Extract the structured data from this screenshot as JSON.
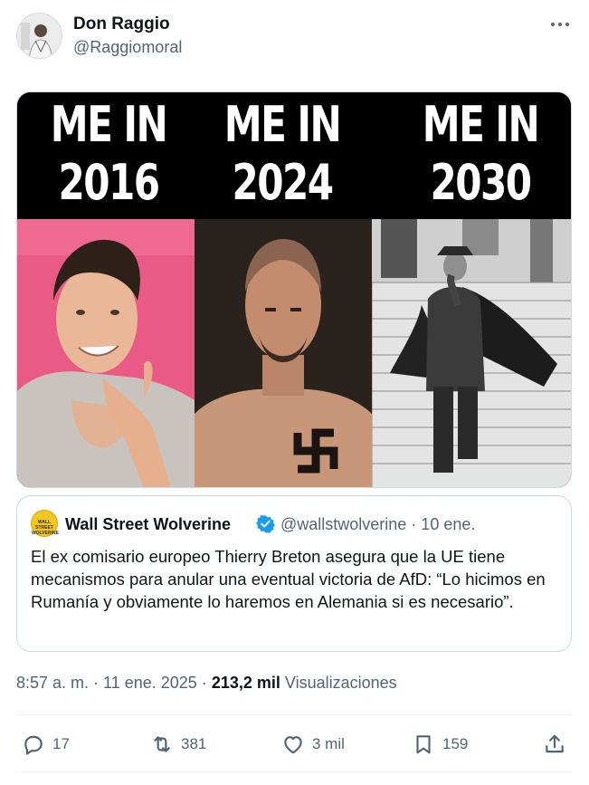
{
  "author": {
    "name": "Don Raggio",
    "handle": "@Raggiomoral"
  },
  "media": {
    "panels": [
      {
        "line1": "ME IN",
        "line2": "2016"
      },
      {
        "line1": "ME IN",
        "line2": "2024"
      },
      {
        "line1": "ME IN",
        "line2": "2030"
      }
    ]
  },
  "quote": {
    "avatar_text": "WALL STREET WOLVERINE",
    "name": "Wall Street Wolverine",
    "handle_date": "@wallstwolverine · 10 ene.",
    "text": "El ex comisario europeo Thierry Breton asegura que la UE tiene mecanismos para anular una eventual victoria de AfD: “Lo hicimos en Rumanía y obviamente lo haremos en Alemania si es necesario”."
  },
  "meta": {
    "time_date": "8:57 a. m. · 11 ene. 2025 · ",
    "views_count": "213,2 mil",
    "views_label": "Visualizaciones"
  },
  "actions": {
    "replies": "17",
    "reposts": "381",
    "likes": "3 mil",
    "bookmarks": "159"
  },
  "colors": {
    "text_primary": "#0f1419",
    "text_secondary": "#536471",
    "verified": "#1d9bf0",
    "border": "#cfd9de"
  }
}
